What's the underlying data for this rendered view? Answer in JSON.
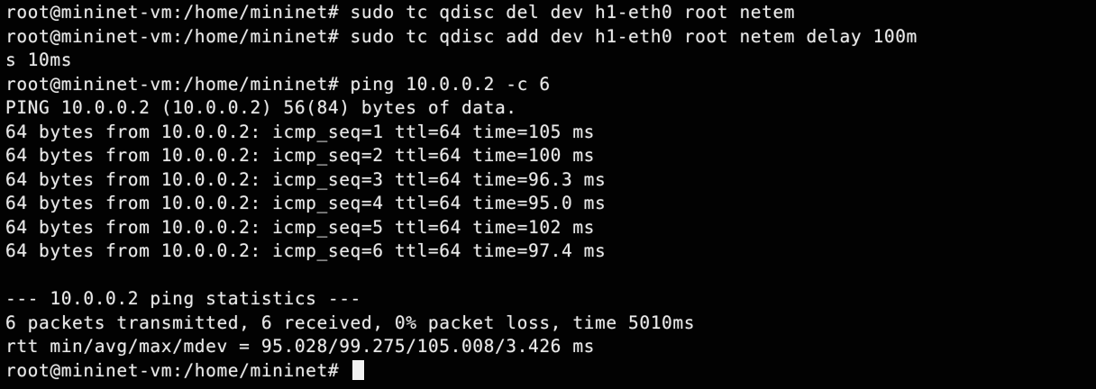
{
  "terminal": {
    "lines": [
      "root@mininet-vm:/home/mininet# sudo tc qdisc del dev h1-eth0 root netem",
      "root@mininet-vm:/home/mininet# sudo tc qdisc add dev h1-eth0 root netem delay 100m",
      "s 10ms",
      "root@mininet-vm:/home/mininet# ping 10.0.0.2 -c 6",
      "PING 10.0.0.2 (10.0.0.2) 56(84) bytes of data.",
      "64 bytes from 10.0.0.2: icmp_seq=1 ttl=64 time=105 ms",
      "64 bytes from 10.0.0.2: icmp_seq=2 ttl=64 time=100 ms",
      "64 bytes from 10.0.0.2: icmp_seq=3 ttl=64 time=96.3 ms",
      "64 bytes from 10.0.0.2: icmp_seq=4 ttl=64 time=95.0 ms",
      "64 bytes from 10.0.0.2: icmp_seq=5 ttl=64 time=102 ms",
      "64 bytes from 10.0.0.2: icmp_seq=6 ttl=64 time=97.4 ms",
      "",
      "--- 10.0.0.2 ping statistics ---",
      "6 packets transmitted, 6 received, 0% packet loss, time 5010ms",
      "rtt min/avg/max/mdev = 95.028/99.275/105.008/3.426 ms"
    ],
    "prompt": "root@mininet-vm:/home/mininet# ",
    "colors": {
      "background": "#020202",
      "foreground": "#e9e9e9",
      "cursor": "#f2f2f2"
    }
  }
}
